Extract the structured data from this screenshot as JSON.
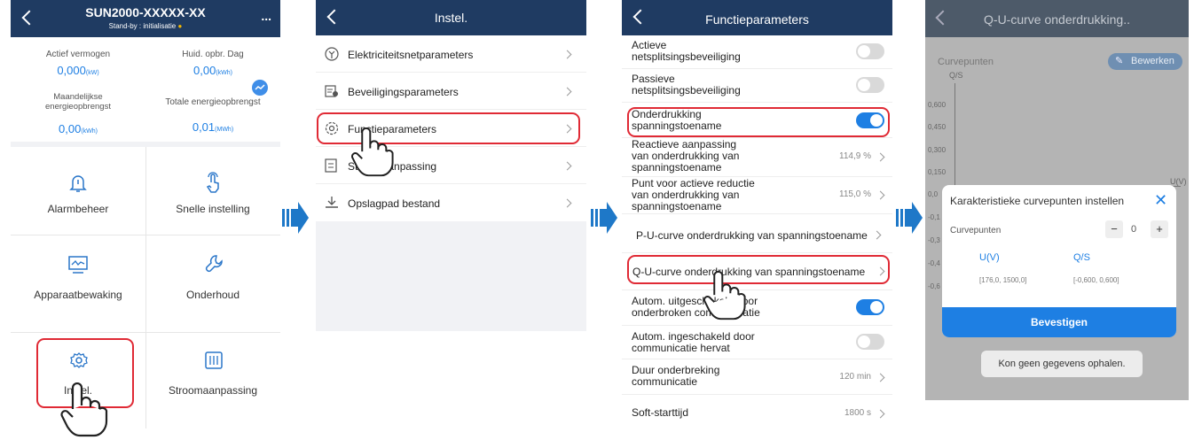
{
  "screen1": {
    "title": "SUN2000-XXXXX-XX",
    "status": "Stand-by : initialisatie",
    "more": "...",
    "stats": [
      {
        "label": "Actief vermogen",
        "value": "0,000",
        "unit": "(kW)"
      },
      {
        "label": "Huid. opbr. Dag",
        "value": "0,00",
        "unit": "(kWh)"
      },
      {
        "label": "Maandelijkse energieopbrengst",
        "value": "0,00",
        "unit": "(kWh)"
      },
      {
        "label": "Totale energieopbrengst",
        "value": "0,01",
        "unit": "(MWh)"
      }
    ],
    "tiles": [
      "Alarmbeheer",
      "Snelle instelling",
      "Apparaatbewaking",
      "Onderhoud",
      "Instel.",
      "Stroomaanpassing"
    ]
  },
  "screen2": {
    "title": "Instel.",
    "items": [
      "Elektriciteitsnetparameters",
      "Beveiligingsparameters",
      "Functieparameters",
      "Stroomaanpassing",
      "Opslagpad bestand"
    ]
  },
  "screen3": {
    "title": "Functieparameters",
    "rows": [
      {
        "label1": "Actieve",
        "label2": "netsplitsingsbeveiliging",
        "type": "toggle",
        "state": "off"
      },
      {
        "label1": "Passieve",
        "label2": "netsplitsingsbeveiliging",
        "type": "toggle",
        "state": "off"
      },
      {
        "label1": "Onderdrukking",
        "label2": "spanningstoename",
        "type": "toggle",
        "state": "on"
      },
      {
        "label1": "Reactieve aanpassing",
        "label2": "van onderdrukking van",
        "label3": "spanningstoename",
        "type": "value",
        "value": "114,9 %"
      },
      {
        "label1": "Punt voor actieve reductie",
        "label2": "van onderdrukking van",
        "label3": "spanningstoename",
        "type": "value",
        "value": "115,0 %"
      },
      {
        "label1": "P-U-curve onderdrukking van spanningstoename",
        "type": "nav"
      },
      {
        "label1": "Q-U-curve onderdrukking van spanningstoename",
        "type": "nav"
      },
      {
        "label1": "Autom. uitgeschakeld door",
        "label2": "onderbroken communicatie",
        "type": "toggle",
        "state": "on"
      },
      {
        "label1": "Autom. ingeschakeld door",
        "label2": "communicatie hervat",
        "type": "toggle",
        "state": "off"
      },
      {
        "label1": "Duur onderbreking",
        "label2": "communicatie",
        "type": "value",
        "value": "120 min"
      },
      {
        "label1": "Soft-starttijd",
        "type": "value",
        "value": "1800 s"
      }
    ]
  },
  "screen4": {
    "title": "Q-U-curve onderdrukking..",
    "curve_label": "Curvepunten",
    "edit": "Bewerken",
    "y_axis": "Q/S",
    "x_axis": "U(V)",
    "ticks": [
      "0,600",
      "0,450",
      "0,300",
      "0,150",
      "0,0",
      "-0,1",
      "-0,3",
      "-0,4",
      "-0,6"
    ],
    "dialog": {
      "title": "Karakteristieke curvepunten instellen",
      "count_label": "Curvepunten",
      "minus": "−",
      "count": "0",
      "plus": "+",
      "col1": "U(V)",
      "col2": "Q/S",
      "range1": "[176,0, 1500,0]",
      "range2": "[-0,600, 0,600]",
      "confirm": "Bevestigen"
    },
    "toast": "Kon geen gegevens ophalen."
  },
  "colors": {
    "header": "#1f3b62",
    "accent": "#1e7fe3",
    "highlight": "#e02a35",
    "arrow": "#1e78c8"
  }
}
